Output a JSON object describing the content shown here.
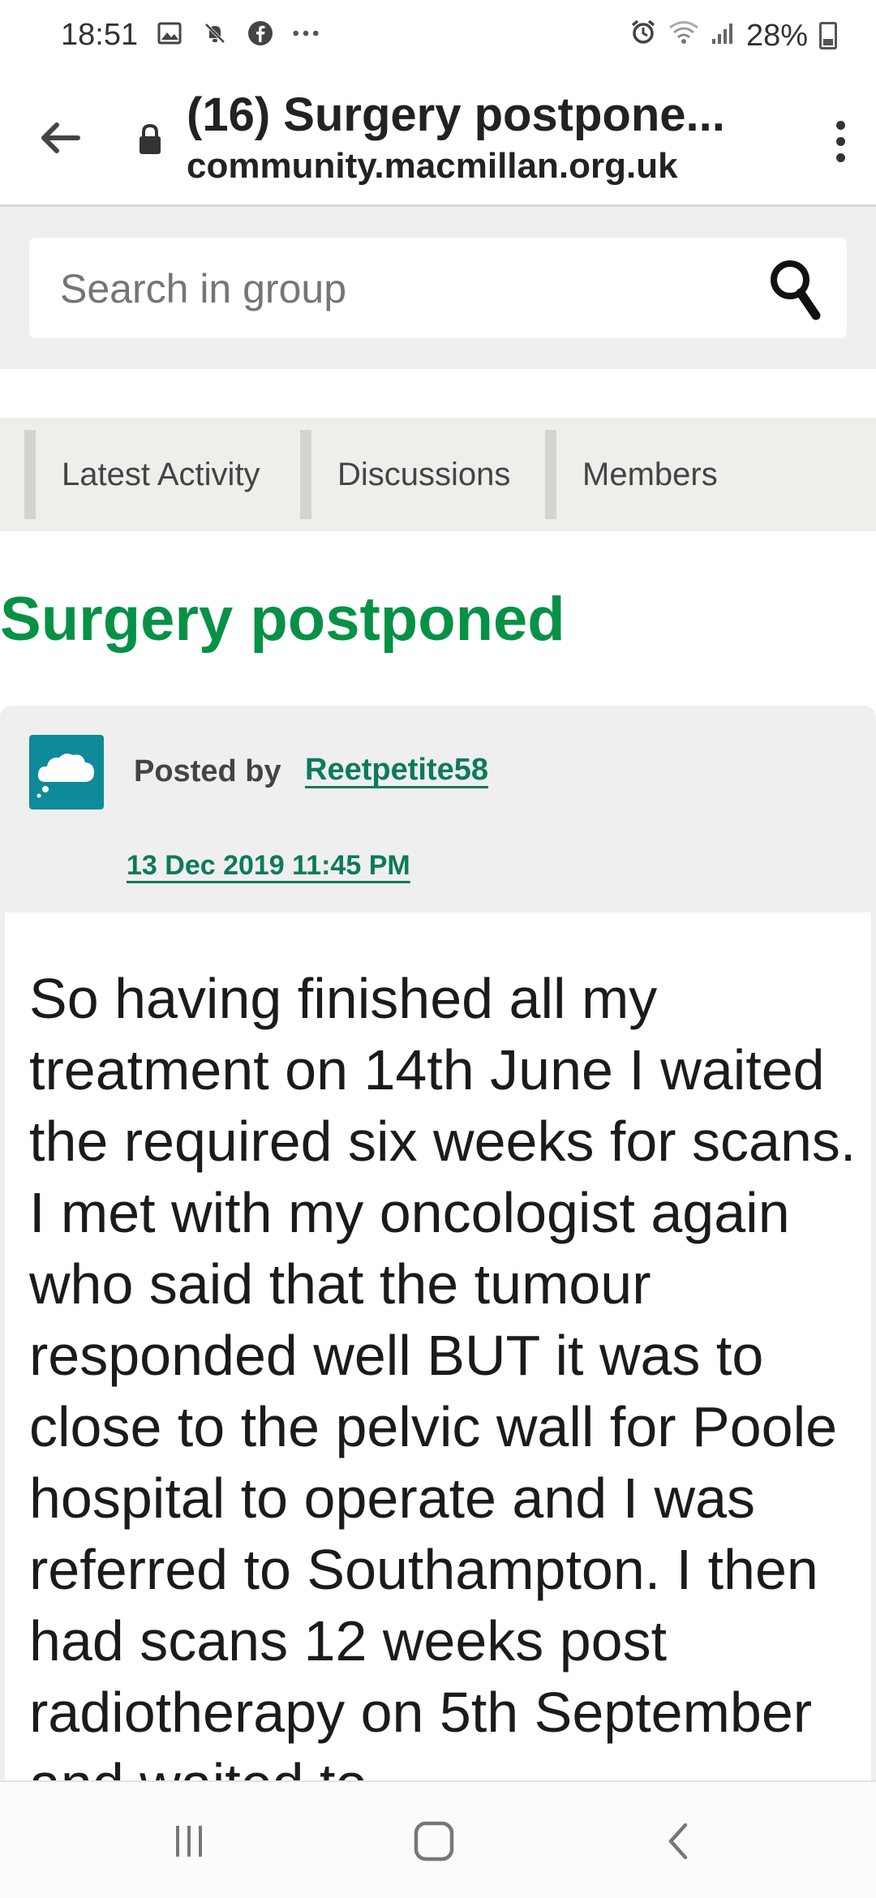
{
  "status_bar": {
    "time": "18:51",
    "left_icons": [
      "gallery-icon",
      "mute-bell-icon",
      "facebook-icon",
      "more-dots-icon"
    ],
    "right_icons": [
      "alarm-icon",
      "wifi-icon",
      "signal-icon",
      "battery-icon"
    ],
    "battery": "28%"
  },
  "browser": {
    "tab_title": "(16) Surgery postpone...",
    "domain": "community.macmillan.org.uk"
  },
  "search": {
    "placeholder": "Search in group"
  },
  "tabs": [
    {
      "label": "Latest Activity"
    },
    {
      "label": "Discussions"
    },
    {
      "label": "Members"
    }
  ],
  "page": {
    "title": "Surgery postponed"
  },
  "post": {
    "posted_by_label": "Posted by",
    "author": "Reetpetite58",
    "date": "13 Dec 2019 11:45 PM",
    "body": "So having finished all my treatment on 14th June I waited the required six weeks for scans. I met with my oncologist again who said that the tumour responded well BUT it was to close to the pelvic wall for Poole hospital to operate and I was referred to Southampton. I then had scans 12 weeks post radiotherapy on 5th September and waited to"
  },
  "colors": {
    "accent_green": "#079146",
    "link_green": "#0c7a5c",
    "avatar_teal": "#0f8a9a"
  }
}
